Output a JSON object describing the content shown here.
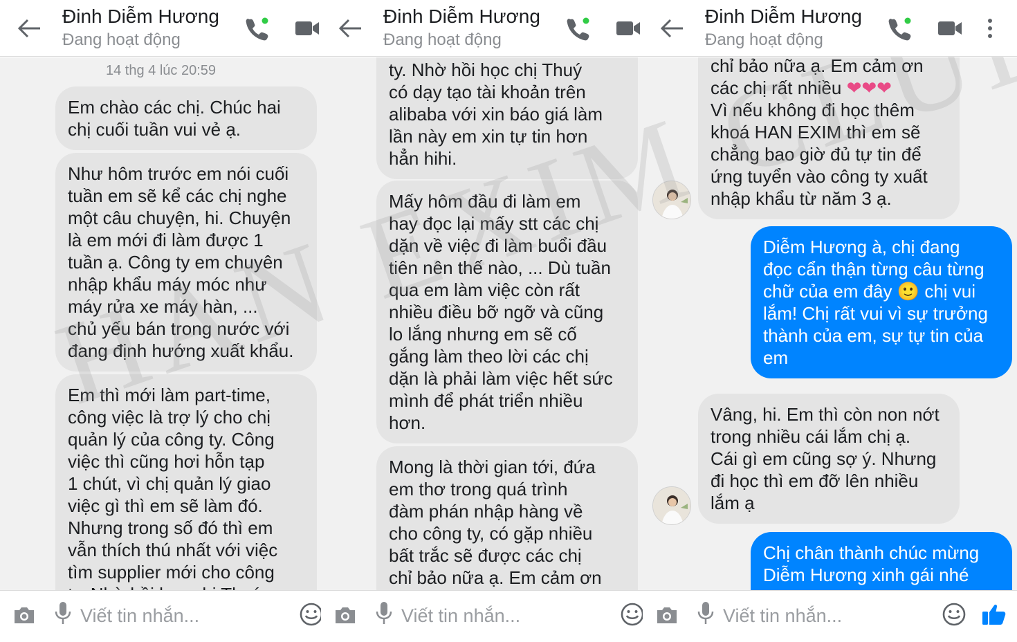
{
  "contact": {
    "name": "Đinh Diễm Hương",
    "status": "Đang hoạt động"
  },
  "composer": {
    "placeholder": "Viết tin nhắn..."
  },
  "icons": {
    "back": "arrow-left-icon",
    "call": "phone-icon",
    "video": "video-camera-icon",
    "more": "more-vertical-icon",
    "camera": "camera-icon",
    "mic": "microphone-icon",
    "emoji": "emoji-icon",
    "like": "thumbs-up-icon"
  },
  "colors": {
    "outgoing_bubble": "#0084ff",
    "incoming_bubble": "#e4e4e4",
    "accent": "#0084ff",
    "online_dot": "#31cc46",
    "heart": "#e94a86"
  },
  "watermark": "HAN EXIM CLUB",
  "panel1": {
    "timestamp": "14 thg 4 lúc 20:59",
    "messages": [
      {
        "dir": "in",
        "text": "Em chào các chị. Chúc hai\nchị cuối tuần vui vẻ ạ."
      },
      {
        "dir": "in",
        "text": "Như hôm trước em nói cuối\ntuần em sẽ kể các chị nghe\nmột câu chuyện, hi. Chuyện\nlà em mới đi làm được 1\ntuần ạ. Công ty em chuyên\nnhập khẩu máy móc như\nmáy rửa xe máy hàn, ...\nchủ yếu bán trong nước với\nđang định hướng xuất khẩu."
      },
      {
        "dir": "in",
        "text": "Em thì mới làm part-time,\ncông việc là trợ lý cho chị\nquản lý của công ty. Công\nviệc thì cũng hơi hỗn tạp\n1 chút, vì chị quản lý giao\nviệc gì thì em sẽ làm đó.\nNhưng trong số đó thì em\nvẫn thích thú nhất với việc\ntìm supplier mới cho công\nty. Nhờ hồi học chị Thuý"
      }
    ]
  },
  "panel2": {
    "messages": [
      {
        "dir": "in",
        "text": "ty. Nhờ hồi học chị Thuý\ncó dạy tạo tài khoản trên\nalibaba với xin báo giá làm\nlần này em xin tự tin hơn\nhẳn hihi."
      },
      {
        "dir": "in",
        "text": "Mấy hôm đầu đi làm em\nhay đọc lại mấy stt các chị\ndặn về việc đi làm buổi đầu\ntiên nên thế nào, ... Dù tuần\nqua em làm việc còn rất\nnhiều điều bỡ ngỡ và cũng\nlo lắng nhưng em sẽ cố\ngắng làm theo lời các chị\ndặn là phải làm việc hết sức\nmình để phát triển nhiều\nhơn."
      },
      {
        "dir": "in",
        "text": "Mong là thời gian tới, đứa\nem thơ trong quá trình\nđàm phán nhập hàng về\ncho công ty, có gặp nhiều\nbất trắc sẽ được các chị\nchỉ bảo nữa ạ. Em cảm ơn"
      }
    ]
  },
  "panel3": {
    "messages": [
      {
        "dir": "in",
        "text": "chỉ bảo nữa ạ. Em cảm ơn\ncác chị rất nhiều ❤❤❤\nVì nếu không đi học thêm\nkhoá HAN EXIM thì em sẽ\nchẳng bao giờ đủ tự tin để\nứng tuyển vào công ty xuất\nnhập khẩu từ năm 3 ạ."
      },
      {
        "dir": "out",
        "text": "Diễm Hương à, chị đang\nđọc cẩn thận từng câu từng\nchữ của em đây 🙂 chị vui\nlắm! Chị rất vui vì sự trưởng\nthành của em, sự tự tin của\nem"
      },
      {
        "dir": "in",
        "text": "Vâng, hi. Em thì còn non nớt\ntrong nhiều cái lắm chị ạ.\nCái gì em cũng sợ ý. Nhưng\nđi học thì em đỡ lên nhiều\nlắm ạ"
      },
      {
        "dir": "out",
        "text": "Chị chân thành chúc mừng\nDiễm Hương xinh gái nhé"
      }
    ]
  }
}
